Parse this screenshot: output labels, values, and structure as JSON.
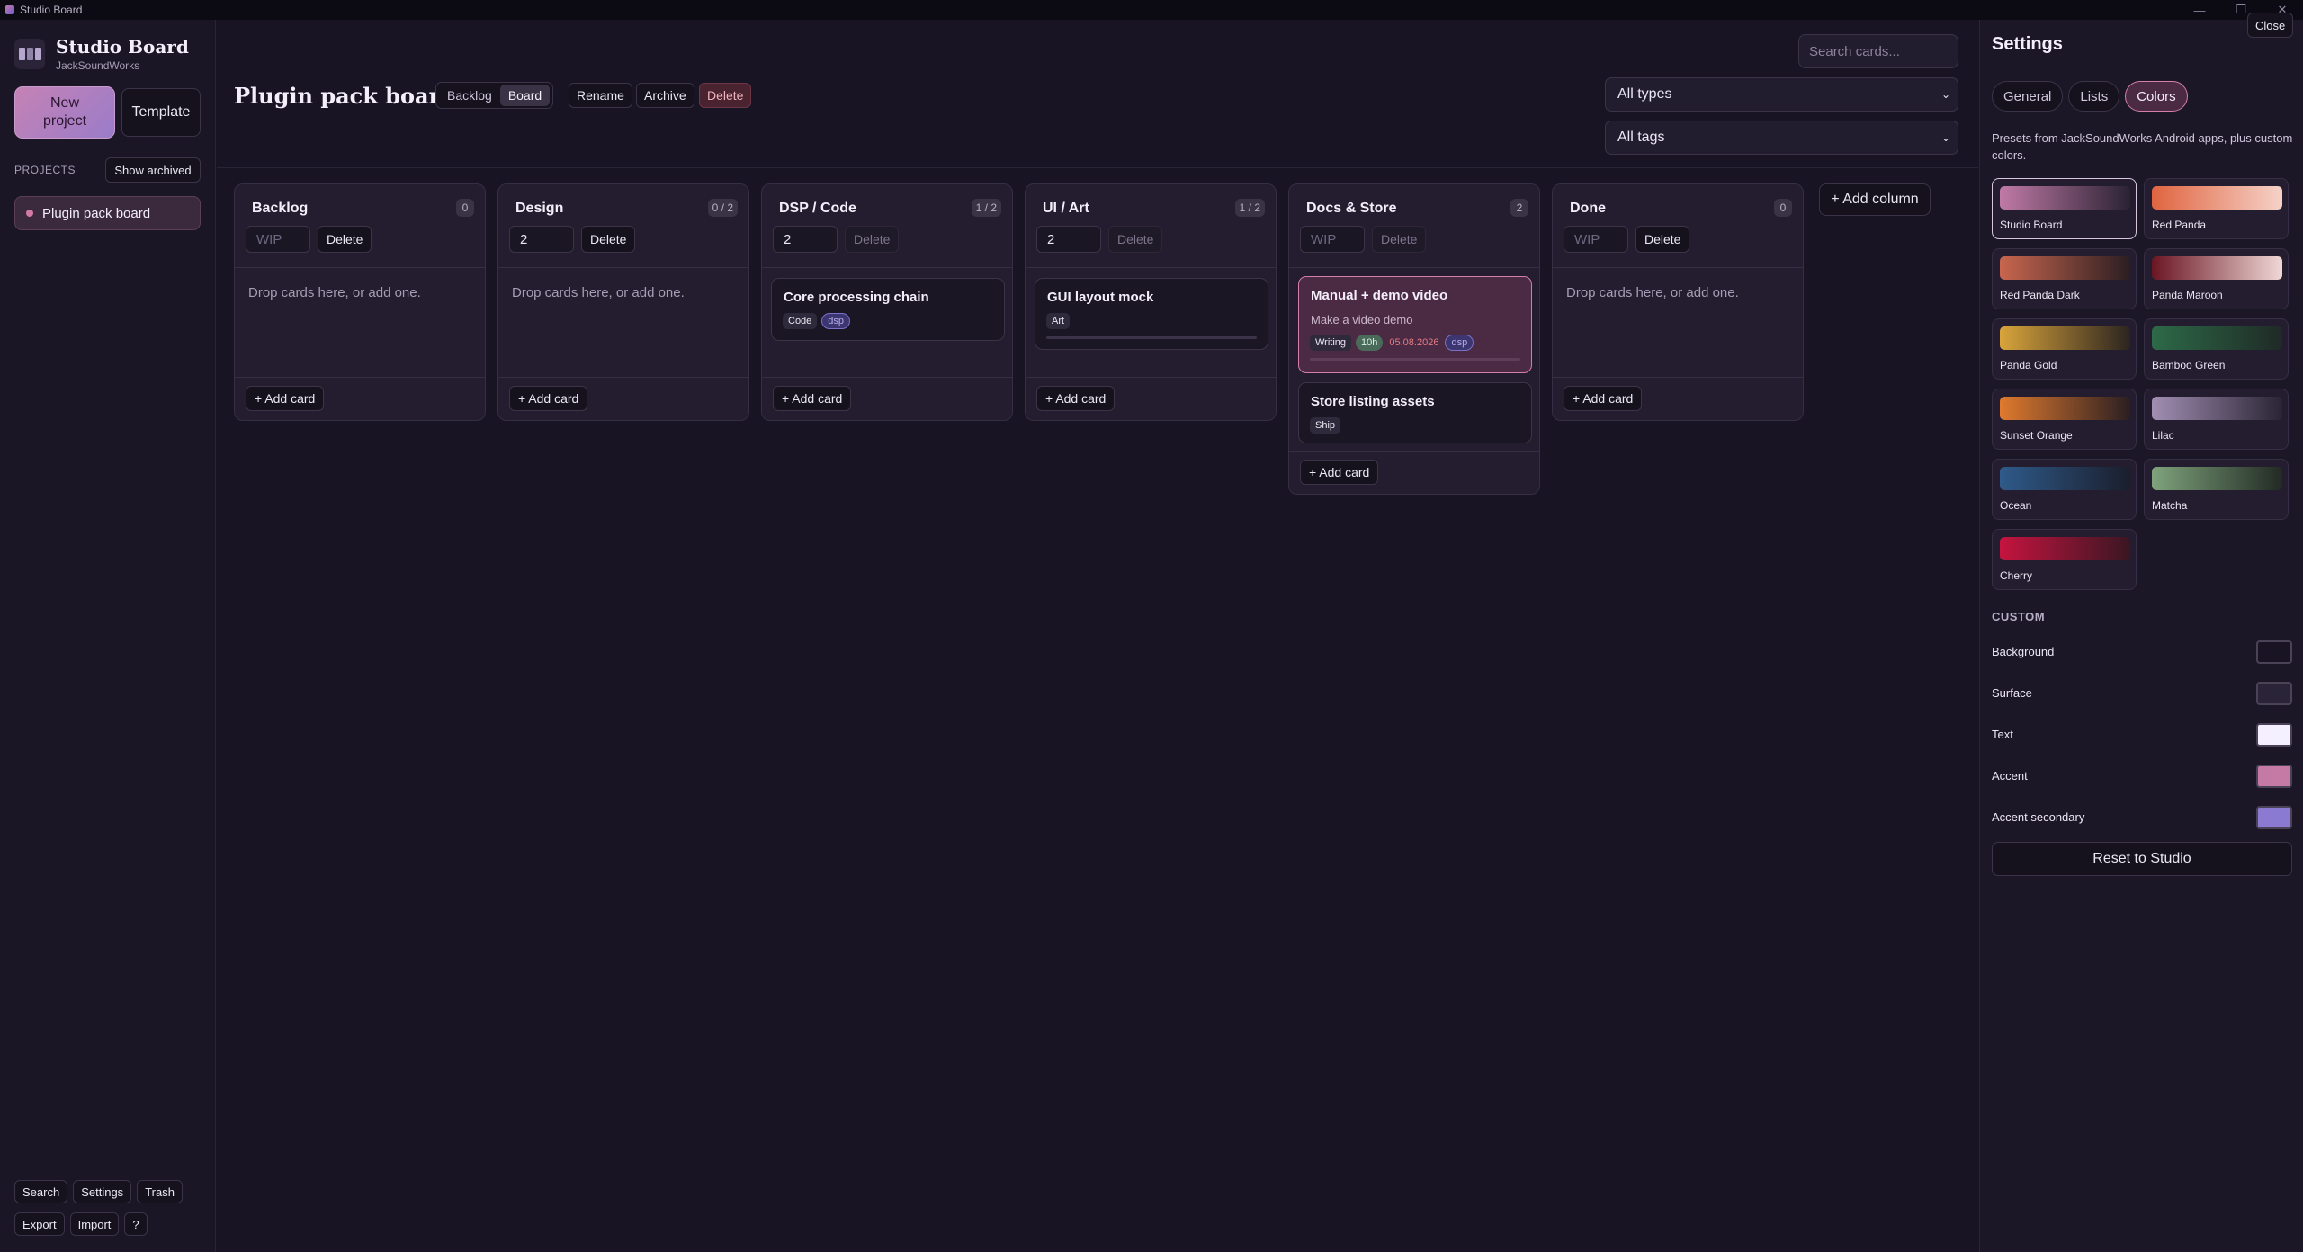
{
  "window": {
    "title": "Studio Board",
    "controls": [
      "—",
      "❐",
      "✕"
    ]
  },
  "brand": {
    "title": "Studio Board",
    "subtitle": "JackSoundWorks"
  },
  "sidebar": {
    "new_project": "New project",
    "template": "Template",
    "projects_label": "PROJECTS",
    "show_archived": "Show archived",
    "projects": [
      {
        "name": "Plugin pack board",
        "color": "#d27aa6"
      }
    ],
    "bottom_row1": [
      "Search",
      "Settings",
      "Trash"
    ],
    "bottom_row2": [
      "Export",
      "Import",
      "?"
    ]
  },
  "header": {
    "board_title": "Plugin pack board",
    "views": [
      "Backlog",
      "Board"
    ],
    "active_view": "Board",
    "rename": "Rename",
    "archive": "Archive",
    "delete": "Delete",
    "search_placeholder": "Search cards...",
    "type_filter": "All types",
    "tag_filter": "All tags"
  },
  "columns": [
    {
      "title": "Backlog",
      "count": "0",
      "wip": "",
      "wip_placeholder": "WIP",
      "delete": "Delete",
      "empty": "Drop cards here, or add one.",
      "add_card": "+ Add card"
    },
    {
      "title": "Design",
      "count": "0 / 2",
      "wip": "2",
      "wip_placeholder": "WIP",
      "delete": "Delete",
      "empty": "Drop cards here, or add one.",
      "add_card": "+ Add card"
    },
    {
      "title": "DSP / Code",
      "count": "1 / 2",
      "wip": "2",
      "wip_placeholder": "WIP",
      "delete": "Delete",
      "add_card": "+ Add card",
      "cards": [
        {
          "title": "Core processing chain",
          "tags": [
            "Code"
          ],
          "secondary_tags": [
            "dsp"
          ]
        }
      ]
    },
    {
      "title": "UI / Art",
      "count": "1 / 2",
      "wip": "2",
      "wip_placeholder": "WIP",
      "delete": "Delete",
      "add_card": "+ Add card",
      "cards": [
        {
          "title": "GUI layout mock",
          "tags": [
            "Art"
          ],
          "progress": 0
        }
      ]
    },
    {
      "title": "Docs & Store",
      "count": "2",
      "wip": "",
      "wip_placeholder": "WIP",
      "delete": "Delete",
      "add_card": "+ Add card",
      "cards": [
        {
          "title": "Manual + demo video",
          "description": "Make a video demo",
          "tags": [
            "Writing"
          ],
          "estimate": "10h",
          "due": "05.08.2026",
          "secondary_tags": [
            "dsp"
          ],
          "progress": 0
        },
        {
          "title": "Store listing assets",
          "tags": [
            "Ship"
          ]
        }
      ]
    },
    {
      "title": "Done",
      "count": "0",
      "wip": "",
      "wip_placeholder": "WIP",
      "delete": "Delete",
      "empty": "Drop cards here, or add one.",
      "add_card": "+ Add card"
    }
  ],
  "add_column": "+ Add column",
  "settings": {
    "title": "Settings",
    "close": "Close",
    "tabs": [
      "General",
      "Lists",
      "Colors"
    ],
    "active_tab": "Colors",
    "presets_desc": "Presets from JackSoundWorks Android apps, plus custom colors.",
    "presets": [
      {
        "name": "Studio Board",
        "from": "#c07aa6",
        "to": "#2a2234",
        "active": true
      },
      {
        "name": "Red Panda",
        "from": "#e0643f",
        "to": "#f5d2c9"
      },
      {
        "name": "Red Panda Dark",
        "from": "#c8664e",
        "to": "#2b1e22"
      },
      {
        "name": "Panda Maroon",
        "from": "#6a1522",
        "to": "#f0d8d6"
      },
      {
        "name": "Panda Gold",
        "from": "#d9a43b",
        "to": "#2b2420"
      },
      {
        "name": "Bamboo Green",
        "from": "#2d6a48",
        "to": "#1f2a26"
      },
      {
        "name": "Sunset Orange",
        "from": "#e07a2e",
        "to": "#2b1f22"
      },
      {
        "name": "Lilac",
        "from": "#a28fb3",
        "to": "#2a2434"
      },
      {
        "name": "Ocean",
        "from": "#2f5a8a",
        "to": "#1a1e2c"
      },
      {
        "name": "Matcha",
        "from": "#7fa37c",
        "to": "#222a24"
      },
      {
        "name": "Cherry",
        "from": "#c5143f",
        "to": "#3a1622"
      }
    ],
    "custom_label": "CUSTOM",
    "custom": [
      {
        "label": "Background",
        "color": "#181423"
      },
      {
        "label": "Surface",
        "color": "#2a2438"
      },
      {
        "label": "Text",
        "color": "#f4f0ff"
      },
      {
        "label": "Accent",
        "color": "#c57aa6"
      },
      {
        "label": "Accent secondary",
        "color": "#8a7ad1"
      }
    ],
    "reset": "Reset to Studio"
  }
}
